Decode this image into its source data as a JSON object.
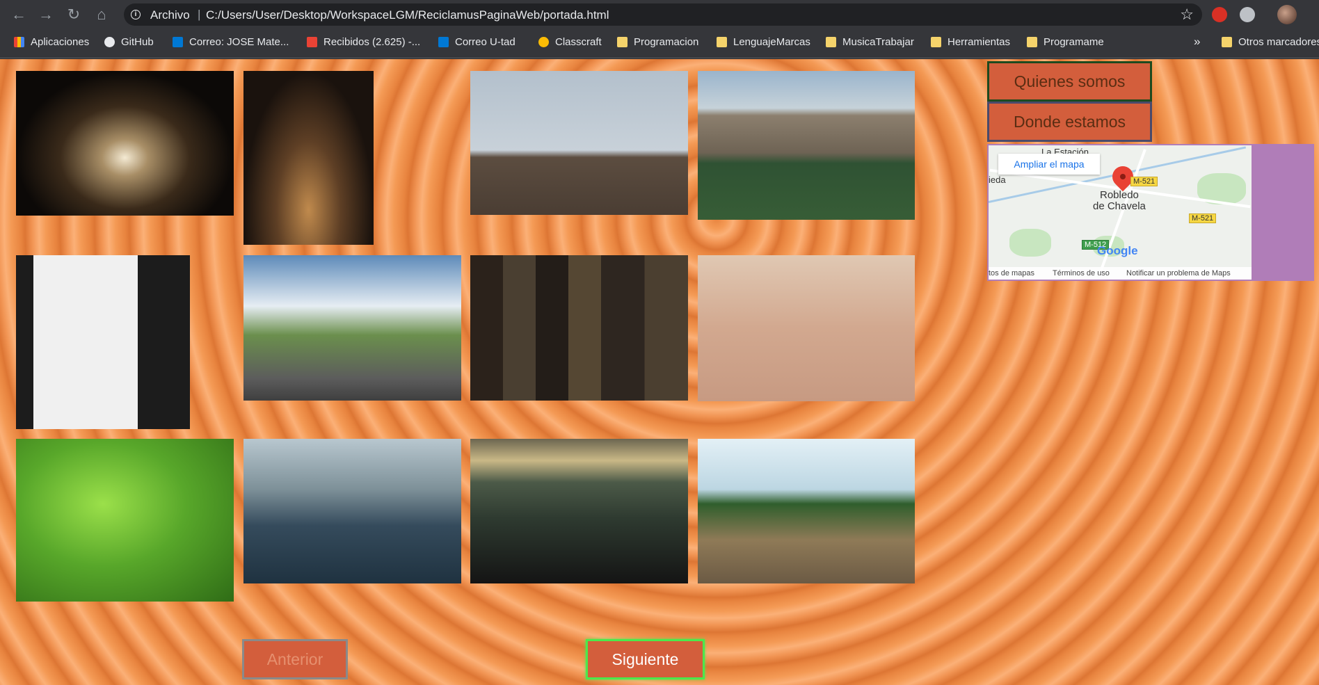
{
  "browser": {
    "scheme_label": "Archivo",
    "url_separator": "|",
    "url": "C:/Users/User/Desktop/WorkspaceLGM/ReciclamusPaginaWeb/portada.html",
    "icons": {
      "back": "arrow-left-icon",
      "forward": "arrow-right-icon",
      "reload": "reload-icon",
      "home": "home-icon",
      "info": "info-icon",
      "bookmark": "star-icon"
    }
  },
  "bookmarks": {
    "items": [
      {
        "label": "Aplicaciones",
        "icon": "apps-icon"
      },
      {
        "label": "GitHub",
        "icon": "github-icon"
      },
      {
        "label": "Correo: JOSE Mate...",
        "icon": "outlook-icon"
      },
      {
        "label": "Recibidos (2.625) -...",
        "icon": "gmail-icon"
      },
      {
        "label": "Correo U-tad",
        "icon": "outlook-icon"
      },
      {
        "label": "Classcraft",
        "icon": "classcraft-icon"
      },
      {
        "label": "Programacion",
        "icon": "folder-icon"
      },
      {
        "label": "LenguajeMarcas",
        "icon": "folder-icon"
      },
      {
        "label": "MusicaTrabajar",
        "icon": "folder-icon"
      },
      {
        "label": "Herramientas",
        "icon": "folder-icon"
      },
      {
        "label": "Programame",
        "icon": "folder-icon"
      }
    ],
    "more": "»",
    "other": "Otros marcadores"
  },
  "menu": {
    "quienes": "Quienes somos",
    "donde": "Donde estamos"
  },
  "map": {
    "ampliar": "Ampliar el mapa",
    "town_top": "La Estación",
    "town_left": "ieda",
    "town_main_1": "Robledo",
    "town_main_2": "de Chavela",
    "route_1": "M-521",
    "route_2": "M-521",
    "route_3": "M-512",
    "logo": "Google",
    "footer_1": "tos de mapas",
    "footer_2": "Términos de uso",
    "footer_3": "Notificar un problema de Maps"
  },
  "pagination": {
    "previous": "Anterior",
    "next": "Siguiente"
  }
}
